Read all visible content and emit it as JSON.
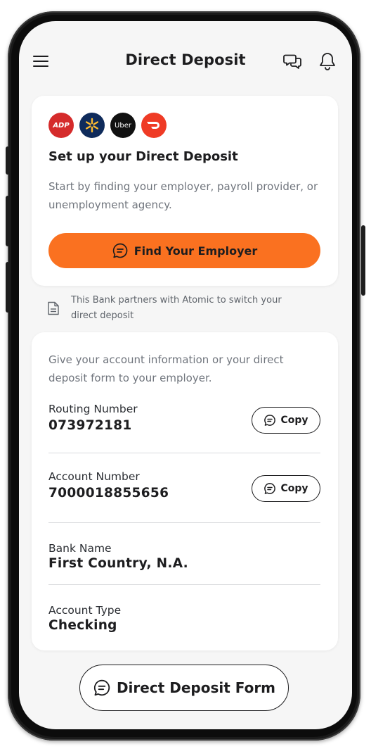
{
  "header": {
    "title": "Direct Deposit",
    "menu_icon": "hamburger-menu-icon",
    "chat_icon": "chat-bubbles-icon",
    "notification_icon": "bell-icon"
  },
  "setup_card": {
    "logos": [
      {
        "name": "adp-logo",
        "text": "ADP",
        "color": "#d52b2b"
      },
      {
        "name": "walmart-logo",
        "text": "",
        "color": "#0f2b5b"
      },
      {
        "name": "uber-logo",
        "text": "Uber",
        "color": "#111111"
      },
      {
        "name": "doordash-logo",
        "text": "",
        "color": "#ef3b25"
      }
    ],
    "title": "Set up your Direct Deposit",
    "description": "Start by finding your employer, payroll provider, or unemployment agency.",
    "find_button_label": "Find Your Employer"
  },
  "partner_note": "This Bank partners with Atomic to switch your direct deposit",
  "account_card": {
    "description": "Give your account information or your direct deposit form to your employer.",
    "routing": {
      "label": "Routing Number",
      "value": "073972181",
      "copy_label": "Copy"
    },
    "account": {
      "label": "Account Number",
      "value": "7000018855656",
      "copy_label": "Copy"
    },
    "bank": {
      "label": "Bank Name",
      "value": "First Country, N.A."
    },
    "type": {
      "label": "Account Type",
      "value": "Checking"
    }
  },
  "form_button_label": "Direct Deposit Form",
  "colors": {
    "accent": "#fa7120",
    "background": "#f6f6f6",
    "text": "#1d1d1f",
    "muted_text": "#70757d"
  }
}
